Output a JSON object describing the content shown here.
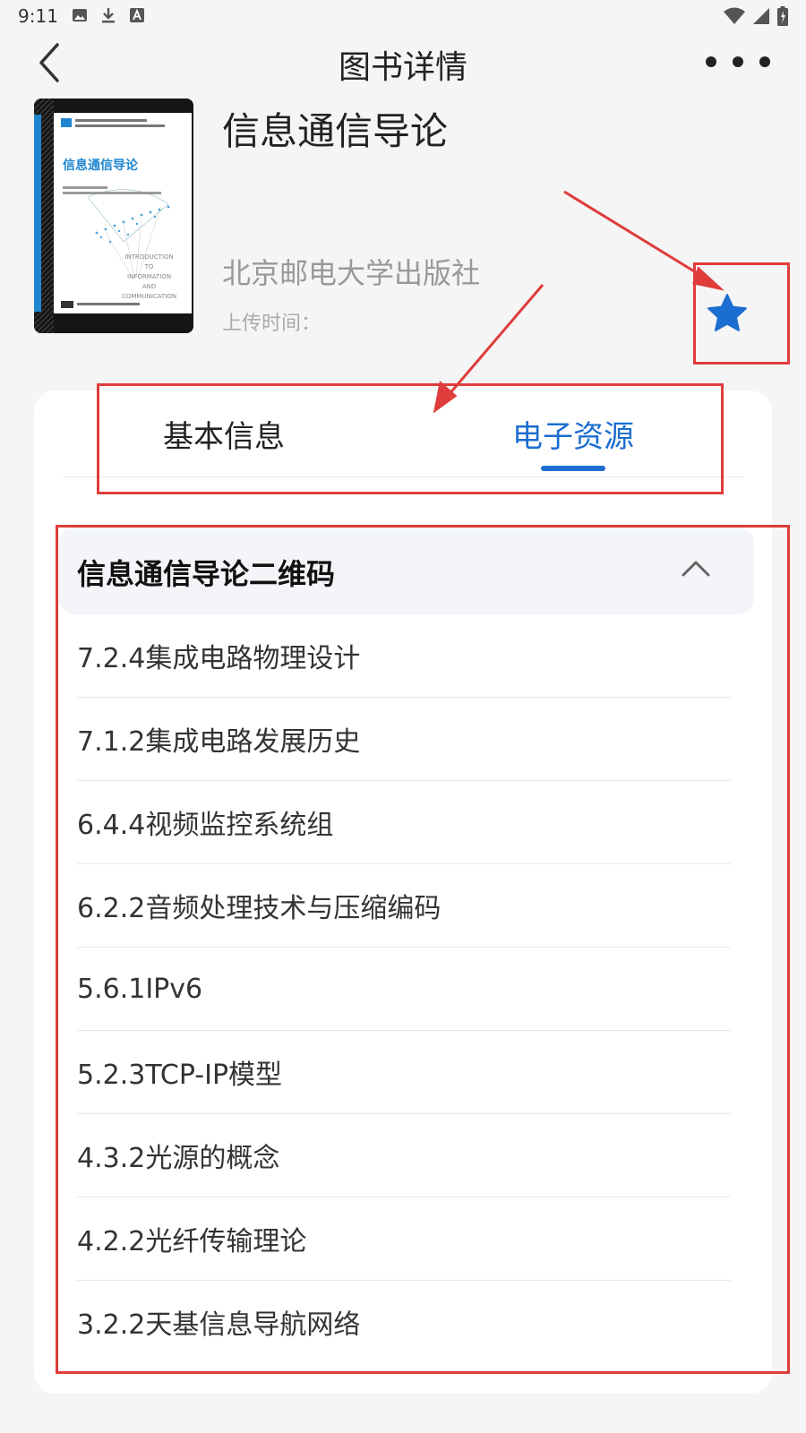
{
  "status_bar": {
    "time": "9:11",
    "left_icons": [
      "image-icon",
      "download-icon",
      "font-icon"
    ],
    "right_icons": [
      "wifi-icon",
      "signal-icon",
      "battery-icon"
    ]
  },
  "navbar": {
    "title": "图书详情",
    "back_icon": "chevron-left-icon",
    "more_icon": "more-icon"
  },
  "book": {
    "title": "信息通信导论",
    "publisher": "北京邮电大学出版社",
    "upload_label": "上传时间：",
    "favorite_icon": "star-icon",
    "favorite_color": "#1c6dd0",
    "cover": {
      "title": "信息通信导论",
      "subtitle_lines": [
        "INTRODUCTION",
        "TO",
        "INFORMATION",
        "AND",
        "COMMUNICATION"
      ]
    }
  },
  "tabs": [
    {
      "label": "基本信息",
      "active": false
    },
    {
      "label": "电子资源",
      "active": true
    }
  ],
  "accent_color": "#1c6dd0",
  "resource_section": {
    "title": "信息通信导论二维码",
    "expanded": true,
    "toggle_icon": "chevron-up-icon",
    "items": [
      "7.2.4集成电路物理设计",
      "7.1.2集成电路发展历史",
      "6.4.4视频监控系统组",
      "6.2.2音频处理技术与压缩编码",
      "5.6.1IPv6",
      "5.2.3TCP-IP模型",
      "4.3.2光源的概念",
      "4.2.2光纤传输理论",
      "3.2.2天基信息导航网络"
    ]
  },
  "annotation_color": "#e03c3c"
}
